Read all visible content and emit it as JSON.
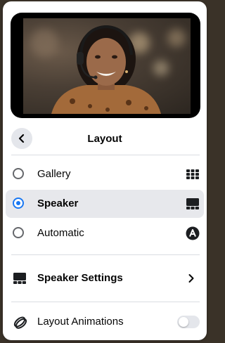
{
  "header": {
    "title": "Layout"
  },
  "layout_options": [
    {
      "label": "Gallery",
      "selected": false,
      "icon": "grid-icon"
    },
    {
      "label": "Speaker",
      "selected": true,
      "icon": "speaker-view-icon"
    },
    {
      "label": "Automatic",
      "selected": false,
      "icon": "automatic-icon"
    }
  ],
  "settings": {
    "speaker_settings_label": "Speaker Settings",
    "layout_animations_label": "Layout Animations",
    "layout_animations_enabled": false
  },
  "colors": {
    "accent": "#1877f2",
    "selected_bg": "#e7e8ec",
    "text": "#050505",
    "divider": "#dadde1"
  },
  "icons": {
    "back": "chevron-left-icon",
    "gallery": "grid-icon",
    "speaker": "speaker-view-icon",
    "automatic": "automatic-icon",
    "speaker_settings": "speaker-settings-icon",
    "chevron": "chevron-right-icon",
    "animations": "layout-animations-icon"
  }
}
